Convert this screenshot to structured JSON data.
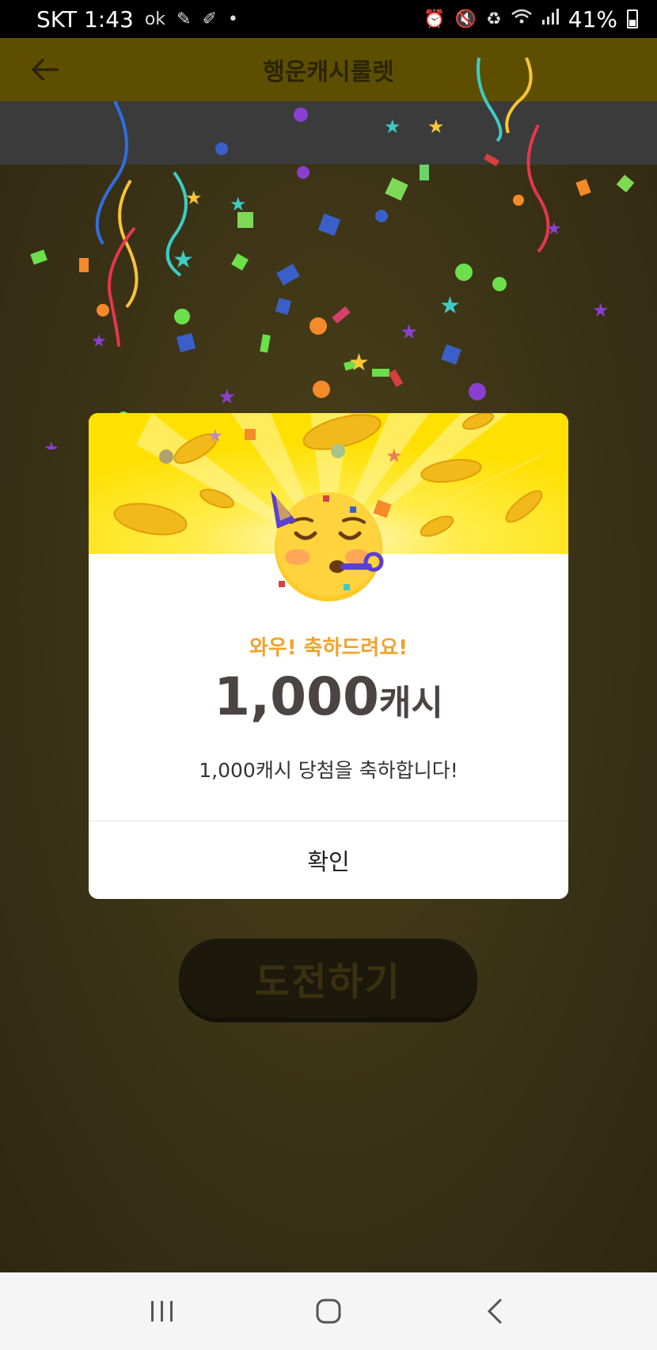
{
  "status_bar": {
    "carrier_time": "SKT 1:43",
    "battery_text": "41%",
    "icons": [
      "ok-icon",
      "settings-icon",
      "pen-icon",
      "dot-icon",
      "alarm-icon",
      "mute-icon",
      "recycle-icon",
      "wifi-icon",
      "signal-icon",
      "battery-icon"
    ]
  },
  "app": {
    "title": "행운캐시룰렛",
    "challenge_button": "도전하기"
  },
  "dialog": {
    "kicker": "와우! 축하드려요!",
    "amount_number": "1,000",
    "amount_unit": "캐시",
    "message": "1,000캐시 당첨을 축하합니다!",
    "confirm_label": "확인"
  },
  "colors": {
    "accent_yellow": "#ffe000",
    "kicker_orange": "#f0a32a",
    "amount_text": "#4c4444"
  }
}
